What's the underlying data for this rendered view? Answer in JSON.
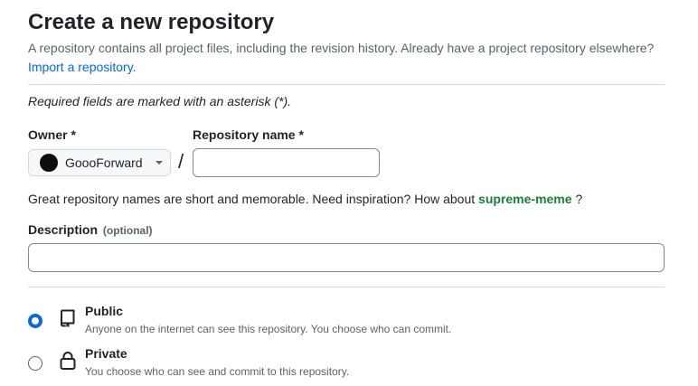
{
  "header": {
    "title": "Create a new repository",
    "subtitle": "A repository contains all project files, including the revision history. Already have a project repository elsewhere?",
    "import_link": "Import a repository."
  },
  "form": {
    "required_note": "Required fields are marked with an asterisk (*).",
    "owner": {
      "label": "Owner *",
      "value": "GoooForward"
    },
    "separator": "/",
    "repository_name": {
      "label": "Repository name *",
      "value": ""
    },
    "hint": {
      "text": "Great repository names are short and memorable. Need inspiration? How about",
      "suggestion": "supreme-meme",
      "suffix": "?"
    },
    "description": {
      "label": "Description",
      "optional": "(optional)",
      "value": ""
    },
    "visibility": [
      {
        "title": "Public",
        "description": "Anyone on the internet can see this repository. You choose who can commit.",
        "selected": true,
        "icon": "repo-icon"
      },
      {
        "title": "Private",
        "description": "You choose who can see and commit to this repository.",
        "selected": false,
        "icon": "lock-icon"
      }
    ]
  },
  "colors": {
    "link": "#0969da",
    "suggestion": "#1a7f37",
    "radio_selected": "#0969da"
  }
}
